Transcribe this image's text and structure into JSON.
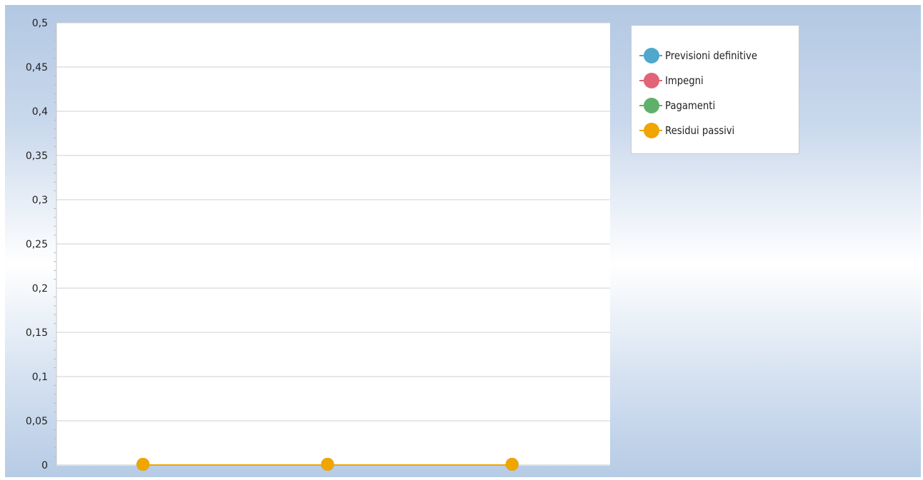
{
  "chart_data": {
    "type": "line",
    "title": "",
    "xlabel": "",
    "ylabel": "",
    "ylim": [
      0,
      0.5
    ],
    "y_ticks": [
      "0",
      "0,05",
      "0,1",
      "0,15",
      "0,2",
      "0,25",
      "0,3",
      "0,35",
      "0,4",
      "0,45",
      "0,5"
    ],
    "y_tick_values": [
      0,
      0.05,
      0.1,
      0.15,
      0.2,
      0.25,
      0.3,
      0.35,
      0.4,
      0.45,
      0.5
    ],
    "grid": true,
    "legend_position": "top-right",
    "x_count": 3,
    "series": [
      {
        "name": "Previsioni definitive",
        "color": "#4fa8cc",
        "values": [
          0,
          0,
          0
        ]
      },
      {
        "name": "Impegni",
        "color": "#e06377",
        "values": [
          0,
          0,
          0
        ]
      },
      {
        "name": "Pagamenti",
        "color": "#5fb06a",
        "values": [
          0,
          0,
          0
        ]
      },
      {
        "name": "Residui passivi",
        "color": "#f0a500",
        "values": [
          0,
          0,
          0
        ]
      }
    ]
  }
}
